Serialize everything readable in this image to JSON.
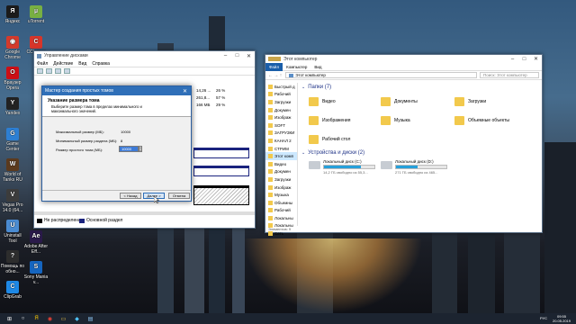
{
  "desktop": {
    "icons": [
      {
        "label": "Яндекс",
        "icon": "yandex-browser-icon",
        "color": "#1b1b1b",
        "glyph": "Я"
      },
      {
        "label": "Google Chrome",
        "icon": "chrome-icon",
        "color": "#d33a2c",
        "glyph": "◉"
      },
      {
        "label": "Браузер Opera",
        "icon": "opera-icon",
        "color": "#cc0f16",
        "glyph": "O"
      },
      {
        "label": "Yandex",
        "icon": "yandex-icon",
        "color": "#222222",
        "glyph": "Y"
      },
      {
        "label": "Game Center",
        "icon": "game-center-icon",
        "color": "#2d7fd3",
        "glyph": "G"
      },
      {
        "label": "World of Tanks RU",
        "icon": "world-of-tanks-icon",
        "color": "#5b3a1e",
        "glyph": "W"
      },
      {
        "label": "Vegas Pro 14.0 (64...",
        "icon": "vegas-pro-icon",
        "color": "#3c3c3c",
        "glyph": "V"
      },
      {
        "label": "Uninstall Tool",
        "icon": "uninstall-tool-icon",
        "color": "#4a8bd1",
        "glyph": "U"
      },
      {
        "label": "Помощь по обно...",
        "icon": "help-update-icon",
        "color": "#2d2d2d",
        "glyph": "?"
      },
      {
        "label": "ClipGrab",
        "icon": "clipgrab-icon",
        "color": "#1e88e5",
        "glyph": "C"
      }
    ],
    "icons_col2": [
      {
        "label": "uTorrent",
        "icon": "utorrent-icon",
        "color": "#78b042",
        "glyph": "µ"
      },
      {
        "label": "CCleaner",
        "icon": "ccleaner-icon",
        "color": "#d7352a",
        "glyph": "C"
      },
      {
        "label": "Adobe After Eff...",
        "icon": "after-effects-icon",
        "color": "#2a1a4a",
        "glyph": "Ae"
      },
      {
        "label": "Sony Mania v...",
        "icon": "sony-mania-icon",
        "color": "#1565c0",
        "glyph": "S"
      }
    ]
  },
  "disk_mgmt": {
    "title": "Управление дисками",
    "menu": [
      "Файл",
      "Действие",
      "Вид",
      "Справка"
    ],
    "rows": [
      {
        "size": "14,26 ...",
        "pct": "26 %"
      },
      {
        "size": "261,8...",
        "pct": "57 %"
      },
      {
        "size": "166 МБ",
        "pct": "29 %"
      }
    ],
    "legend": [
      {
        "label": "Не распределена",
        "color": "#000000"
      },
      {
        "label": "Основной раздел",
        "color": "#1a237e"
      }
    ]
  },
  "wizard": {
    "title": "Мастер создания простых томов",
    "heading": "Указание размера тома",
    "subheading": "Выберите размер тома в пределах минимального и максимального значений.",
    "fields": [
      {
        "label": "Максимальный размер (МБ):",
        "value": "10000"
      },
      {
        "label": "Минимальный размер раздела (МБ):",
        "value": "8"
      },
      {
        "label": "Размер простого тома (МБ):",
        "value": "10000"
      }
    ],
    "buttons": {
      "back": "< Назад",
      "next": "Далее >",
      "cancel": "Отмена"
    }
  },
  "explorer": {
    "title": "Этот компьютер",
    "ribbon_tabs": [
      "Файл",
      "Компьютер",
      "Вид"
    ],
    "address": "Этот компьютер",
    "search_placeholder": "Поиск: Этот компьютер",
    "nav": [
      "Быстрый д",
      "Рабочий",
      "Загрузки",
      "Докумен",
      "Изображ",
      "SOFT",
      "ЗАГРУЗКИ",
      "КАНАЛ 2",
      "СТРИМ",
      "Этот комп",
      "Видео",
      "Докумен",
      "Загрузки",
      "Изображ",
      "Музыка",
      "Объемны",
      "Рабочий",
      "Локальны",
      "Локальны",
      "Сеть"
    ],
    "folders_header": "Папки (7)",
    "folders": [
      {
        "label": "Видео",
        "icon": "video-folder-icon"
      },
      {
        "label": "Документы",
        "icon": "documents-folder-icon"
      },
      {
        "label": "Загрузки",
        "icon": "downloads-folder-icon"
      },
      {
        "label": "Изображения",
        "icon": "pictures-folder-icon"
      },
      {
        "label": "Музыка",
        "icon": "music-folder-icon"
      },
      {
        "label": "Объемные объекты",
        "icon": "3d-objects-folder-icon"
      },
      {
        "label": "Рабочий стол",
        "icon": "desktop-folder-icon"
      }
    ],
    "drives_header": "Устройства и диски (2)",
    "drives": [
      {
        "label": "Локальный диск (C:)",
        "free": "14,2 ГБ свободно из 55,3...",
        "used_fraction": 0.74
      },
      {
        "label": "Локальный диск (D:)",
        "free": "271 ГБ свободно из 465...",
        "used_fraction": 0.42
      }
    ],
    "status": "Элементов: 9"
  },
  "taskbar": {
    "items": [
      {
        "icon": "start-icon",
        "glyph": "⊞",
        "color": "#ffffff"
      },
      {
        "icon": "search-icon",
        "glyph": "○",
        "color": "#ffffff"
      },
      {
        "icon": "yandex-taskbar-icon",
        "glyph": "Я",
        "color": "#ffcc00"
      },
      {
        "icon": "chrome-taskbar-icon",
        "glyph": "◉",
        "color": "#e94235"
      },
      {
        "icon": "explorer-taskbar-icon",
        "glyph": "▭",
        "color": "#f2c94c"
      },
      {
        "icon": "store-taskbar-icon",
        "glyph": "◆",
        "color": "#4fc3f7"
      },
      {
        "icon": "disk-mgmt-taskbar-icon",
        "glyph": "▤",
        "color": "#90caf9"
      }
    ],
    "lang": "РУС",
    "time": "09:55",
    "date": "20.05.2019"
  }
}
